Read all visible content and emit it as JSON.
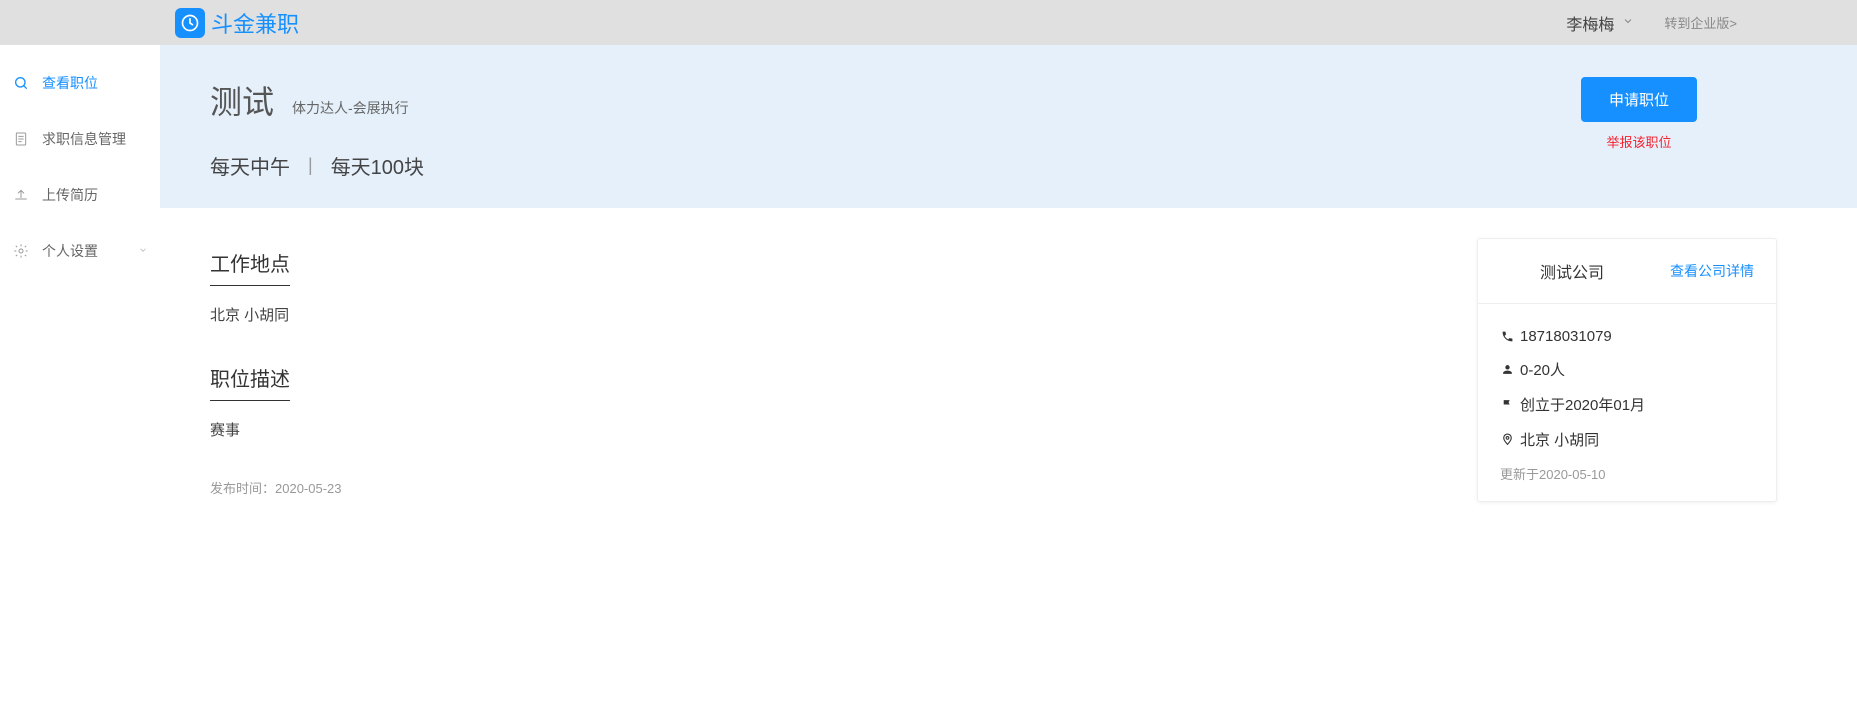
{
  "topbar": {
    "brand": "斗金兼职",
    "user_name": "李梅梅",
    "switch_link": "转到企业版>"
  },
  "sidebar": {
    "items": [
      {
        "label": "查看职位",
        "icon": "search-icon",
        "active": true
      },
      {
        "label": "求职信息管理",
        "icon": "document-icon",
        "active": false
      },
      {
        "label": "上传简历",
        "icon": "upload-icon",
        "active": false
      },
      {
        "label": "个人设置",
        "icon": "gear-icon",
        "active": false,
        "has_children": true
      }
    ]
  },
  "job": {
    "title": "测试",
    "subtitle": "体力达人-会展执行",
    "time_schedule": "每天中午",
    "pay": "每天100块",
    "apply_label": "申请职位",
    "report_label": "举报该职位",
    "location_heading": "工作地点",
    "location_text": "北京 小胡同",
    "description_heading": "职位描述",
    "description_text": "赛事",
    "publish_label": "发布时间：",
    "publish_date": "2020-05-23"
  },
  "company": {
    "name": "测试公司",
    "detail_link": "查看公司详情",
    "phone": "18718031079",
    "size": "0-20人",
    "founded": "创立于2020年01月",
    "location": "北京 小胡同",
    "updated_prefix": "更新于",
    "updated_date": "2020-05-10"
  }
}
